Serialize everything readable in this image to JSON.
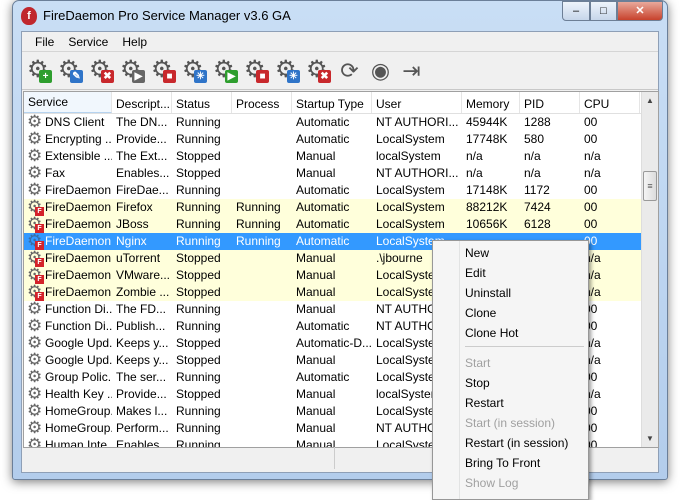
{
  "window": {
    "title": "FireDaemon Pro Service Manager v3.6 GA",
    "minimize": "–",
    "maximize": "□",
    "close": "✕"
  },
  "menu": [
    "File",
    "Service",
    "Help"
  ],
  "toolbar": [
    {
      "name": "new-service",
      "badge": "+",
      "color": "#2e9e2e"
    },
    {
      "name": "edit-service",
      "badge": "✎",
      "color": "#2f74c8"
    },
    {
      "name": "uninstall-service",
      "badge": "✖",
      "color": "#c8282c"
    },
    {
      "name": "start-service",
      "badge": "▶",
      "color": "#666"
    },
    {
      "name": "stop-service",
      "badge": "■",
      "color": "#c8282c"
    },
    {
      "name": "pause-service",
      "badge": "✳",
      "color": "#2f74c8"
    },
    {
      "name": "start-in-session",
      "badge": "▶",
      "color": "#2e9e2e"
    },
    {
      "name": "stop-in-session",
      "badge": "■",
      "color": "#c8282c"
    },
    {
      "name": "pause-in-session",
      "badge": "✳",
      "color": "#2f74c8"
    },
    {
      "name": "uninstall-in-session",
      "badge": "✖",
      "color": "#c8282c"
    }
  ],
  "toolbar_extra": [
    {
      "name": "refresh",
      "glyph": "⟳"
    },
    {
      "name": "view",
      "glyph": "◉"
    },
    {
      "name": "exit",
      "glyph": "⇥"
    }
  ],
  "columns": [
    "Service",
    "Descript...",
    "Status",
    "Process",
    "Startup Type",
    "User",
    "Memory",
    "PID",
    "CPU"
  ],
  "rows": [
    {
      "t": "n",
      "c": [
        "DNS Client",
        "The DN...",
        "Running",
        "",
        "Automatic",
        "NT AUTHORI...",
        "45944K",
        "1288",
        "00"
      ]
    },
    {
      "t": "n",
      "c": [
        "Encrypting ...",
        "Provide...",
        "Running",
        "",
        "Automatic",
        "LocalSystem",
        "17748K",
        "580",
        "00"
      ]
    },
    {
      "t": "n",
      "c": [
        "Extensible ...",
        "The Ext...",
        "Stopped",
        "",
        "Manual",
        "localSystem",
        "n/a",
        "n/a",
        "n/a"
      ]
    },
    {
      "t": "n",
      "c": [
        "Fax",
        "Enables...",
        "Stopped",
        "",
        "Manual",
        "NT AUTHORI...",
        "n/a",
        "n/a",
        "n/a"
      ]
    },
    {
      "t": "n",
      "c": [
        "FireDaemon...",
        "FireDae...",
        "Running",
        "",
        "Automatic",
        "LocalSystem",
        "17148K",
        "1172",
        "00"
      ]
    },
    {
      "t": "fd",
      "c": [
        "FireDaemon...",
        "Firefox",
        "Running",
        "Running",
        "Automatic",
        "LocalSystem",
        "88212K",
        "7424",
        "00"
      ]
    },
    {
      "t": "fd",
      "c": [
        "FireDaemon...",
        "JBoss",
        "Running",
        "Running",
        "Automatic",
        "LocalSystem",
        "10656K",
        "6128",
        "00"
      ]
    },
    {
      "t": "sel",
      "c": [
        "FireDaemon...",
        "Nginx",
        "Running",
        "Running",
        "Automatic",
        "LocalSystem",
        "",
        "",
        "00"
      ]
    },
    {
      "t": "fd",
      "c": [
        "FireDaemon...",
        "uTorrent",
        "Stopped",
        "",
        "Manual",
        ".\\jbourne",
        "",
        "",
        "n/a"
      ]
    },
    {
      "t": "fd",
      "c": [
        "FireDaemon...",
        "VMware...",
        "Stopped",
        "",
        "Manual",
        "LocalSystem",
        "",
        "",
        "n/a"
      ]
    },
    {
      "t": "fd",
      "c": [
        "FireDaemon...",
        "Zombie ...",
        "Stopped",
        "",
        "Manual",
        "LocalSystem",
        "",
        "",
        "n/a"
      ]
    },
    {
      "t": "n",
      "c": [
        "Function Di...",
        "The FD...",
        "Running",
        "",
        "Manual",
        "NT AUTHO",
        "",
        "",
        "00"
      ]
    },
    {
      "t": "n",
      "c": [
        "Function Di...",
        "Publish...",
        "Running",
        "",
        "Automatic",
        "NT AUTHO",
        "",
        "",
        "00"
      ]
    },
    {
      "t": "n",
      "c": [
        "Google Upd...",
        "Keeps y...",
        "Stopped",
        "",
        "Automatic-D...",
        "LocalSystem",
        "",
        "",
        "n/a"
      ]
    },
    {
      "t": "n",
      "c": [
        "Google Upd...",
        "Keeps y...",
        "Stopped",
        "",
        "Manual",
        "LocalSystem",
        "",
        "",
        "n/a"
      ]
    },
    {
      "t": "n",
      "c": [
        "Group Polic...",
        "The ser...",
        "Running",
        "",
        "Automatic",
        "LocalSystem",
        "",
        "",
        "00"
      ]
    },
    {
      "t": "n",
      "c": [
        "Health Key ...",
        "Provide...",
        "Stopped",
        "",
        "Manual",
        "localSystem",
        "",
        "",
        "n/a"
      ]
    },
    {
      "t": "n",
      "c": [
        "HomeGroup...",
        "Makes l...",
        "Running",
        "",
        "Manual",
        "LocalSystem",
        "",
        "",
        "00"
      ]
    },
    {
      "t": "n",
      "c": [
        "HomeGroup...",
        "Perform...",
        "Running",
        "",
        "Manual",
        "NT AUTHO",
        "",
        "",
        "00"
      ]
    },
    {
      "t": "n",
      "c": [
        "Human Inte...",
        "Enables...",
        "Running",
        "",
        "Manual",
        "LocalSystem",
        "",
        "",
        "00"
      ]
    }
  ],
  "context_menu": [
    {
      "label": "New",
      "enabled": true
    },
    {
      "label": "Edit",
      "enabled": true
    },
    {
      "label": "Uninstall",
      "enabled": true
    },
    {
      "label": "Clone",
      "enabled": true
    },
    {
      "label": "Clone Hot",
      "enabled": true
    },
    {
      "sep": true
    },
    {
      "label": "Start",
      "enabled": false
    },
    {
      "label": "Stop",
      "enabled": true
    },
    {
      "label": "Restart",
      "enabled": true
    },
    {
      "label": "Start (in session)",
      "enabled": false
    },
    {
      "label": "Restart (in session)",
      "enabled": true
    },
    {
      "label": "Bring To Front",
      "enabled": true
    },
    {
      "label": "Show Log",
      "enabled": false
    }
  ]
}
